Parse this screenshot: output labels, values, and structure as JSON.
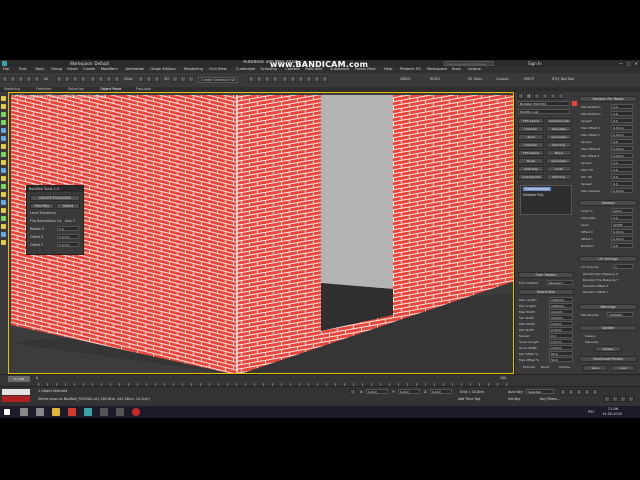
{
  "window": {
    "title": "Autodesk 3ds Max 2018",
    "workspace": "Workspace: Default",
    "search_placeholder": "Type a keyword or phrase",
    "signin": "Sign In",
    "watermark": "www.BANDICAM.com",
    "controls": [
      "—",
      "□",
      "✕"
    ]
  },
  "menu": [
    "File",
    "Edit",
    "Tools",
    "Group",
    "Views",
    "Create",
    "Modifiers",
    "Animation",
    "Graph Editors",
    "Rendering",
    "Civil View",
    "Customize",
    "Scripting",
    "Content",
    "RailClone",
    "Substance",
    "Forest Pack",
    "Help",
    "Phoenix FD",
    "Workspace",
    "Tools",
    "Octane"
  ],
  "toolbar": {
    "selection_filter": "All",
    "view_mode": "View",
    "selection_set": "Create Selection Se",
    "snap": "3D",
    "right_buttons": [
      "UNDO",
      "REDO",
      "PA Tools",
      "Corona",
      "MSCP",
      "RTH_BoxTool"
    ]
  },
  "ribbon_tabs": [
    "Modeling",
    "Freeform",
    "Selection",
    "Object Paint",
    "Populate"
  ],
  "viewport": {
    "label": "[+] [Perspective] [Standard] [Default Shading]",
    "brick_color": "#e8463a",
    "mortar_color": "#f0e8e4",
    "window_glass": "#b4b4b4",
    "window_shadow": "#2f2f2f"
  },
  "float_panel": {
    "title": "BoxWall Tools 1.0",
    "btn_delete": "DELETE POLYGONS",
    "btn_pick": "Pick Poly",
    "btn_select": "Select",
    "lbl_transform": "Local Transform",
    "lbl_flip": "Flip Normal",
    "lbl_axis": "Axis Ox",
    "lbl_axis_y": "Axis Y",
    "lbl_rotate": "Rotate X",
    "rotate_val": "0.0",
    "lbl_offset": "Offset X",
    "offset_val": "0.0mm",
    "lbl_offset2": "Offset Y",
    "offset2_val": "0.0mm"
  },
  "command_panel": {
    "object_name": "BoxWall_POLY002",
    "modifier_list": "Modifier List",
    "buttons": [
      [
        "FFD 2x2x2",
        "TurboSmooth"
      ],
      [
        "Chamfer",
        "Tessellate"
      ],
      [
        "Shell",
        "Symmetry"
      ],
      [
        "Chamfer",
        "Edit Poly"
      ],
      [
        "FFD Select",
        "Bend"
      ],
      [
        "Noise",
        "Symmetry"
      ],
      [
        "UVW Map",
        "Cloth"
      ],
      [
        "UnwrapUVW",
        "Edit Poly"
      ]
    ],
    "stack": [
      "FloorGenerator",
      "Editable Poly"
    ],
    "section_floor_pattern": "Floor Pattern",
    "floor_pattern_label": "Floor Pattern:",
    "floor_pattern_value": "Standard",
    "section_board_size": "Board Size",
    "board_params": [
      [
        "Max Length",
        "1000mm"
      ],
      [
        "Min Length",
        "1000mm"
      ],
      [
        "Max Width",
        "110mm"
      ],
      [
        "Min Width",
        "100mm"
      ],
      [
        "Max Width",
        "0.0mm"
      ],
      [
        "Min Width",
        "0.0mm"
      ],
      [
        "Spread",
        "0.0"
      ],
      [
        "Grout Length",
        "2.0mm"
      ],
      [
        "Grout Width",
        "2.0mm"
      ],
      [
        "Min Offset %",
        "50.0"
      ],
      [
        "Max Offset %",
        "50.0"
      ]
    ],
    "grout_opts": [
      "Extrude",
      "Bevel",
      "Outline"
    ]
  },
  "right_panel": {
    "section_random": "Random Per Board",
    "random_params": [
      [
        "Max Rotation",
        "0.0"
      ],
      [
        "Max Rotation",
        "0.0"
      ],
      [
        "Spread",
        "0.0"
      ],
      [
        "Max Offset X",
        "0.0mm"
      ],
      [
        "Max Offset Y",
        "0.0mm"
      ],
      [
        "Spread",
        "0.0"
      ],
      [
        "Max Offset Z",
        "0.0mm"
      ],
      [
        "Min Offset Z",
        "0.0mm"
      ],
      [
        "Spread",
        "0.0"
      ],
      [
        "Max Tilt",
        "0.0"
      ],
      [
        "Min Tilt",
        "0.0"
      ],
      [
        "Spread",
        "0.0"
      ],
      [
        "Max Overlap",
        "0.0mm"
      ]
    ],
    "section_general": "General",
    "general_params": [
      [
        "Scale %",
        "100.0"
      ],
      [
        "View Size",
        "0.2"
      ],
      [
        "Seed",
        "12345"
      ],
      [
        "Offset X",
        "0.0mm"
      ],
      [
        "Offset Y",
        "0.0mm"
      ],
      [
        "Rotation",
        "0.0"
      ]
    ],
    "section_uv": "UV Settings",
    "uv_channel_label": "UV Channel",
    "uv_channel_value": "1",
    "uv_options": [
      "Random Per Mapping X",
      "Random Flip Mapping Y",
      "Random Offset X",
      "Random Offset Y"
    ],
    "section_warnings": "Warnings",
    "max_boards_label": "Max Boards",
    "max_boards_value": "1000000",
    "section_update": "Update",
    "update_options": [
      "Always",
      "Manually"
    ],
    "update_button": "Update",
    "section_presets": "Save/Load Presets",
    "save_button": "Save",
    "load_button": "Load"
  },
  "timeline": {
    "frame": "0 / 100",
    "tick_start": "0",
    "tick_end": "100"
  },
  "status": {
    "maxscript": "MAXScript Mi",
    "selected": "1 Object Selected",
    "prompt": "Vertex snap on BoxWall_POLY002 at [-505,8cm, 441,36cm, 10,5cm]",
    "x_label": "X:",
    "x_val": "0,0cm",
    "y_label": "Y:",
    "y_val": "0,0cm",
    "z_label": "Z:",
    "z_val": "0,0cm",
    "grid": "Grid = 10,0cm",
    "add_time_tag": "Add Time Tag",
    "autokey": "Auto Key",
    "selected_dd": "Selected",
    "setkey": "Set Key",
    "key_filters": "Key Filters..."
  },
  "taskbar": {
    "time": "21:06",
    "date": "14.05.2020",
    "lang": "РУС"
  }
}
